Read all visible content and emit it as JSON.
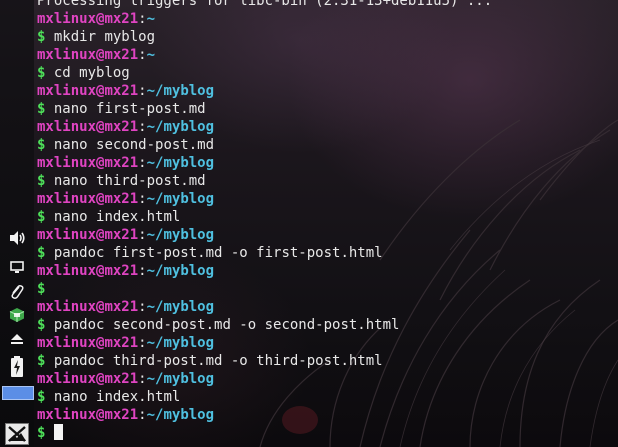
{
  "terminal": {
    "user": "mxlinux",
    "host": "mx21",
    "lines": [
      {
        "type": "output",
        "text": "Processing triggers for libc-bin (2.31-13+deb11u5) ..."
      },
      {
        "type": "prompt",
        "path": "~"
      },
      {
        "type": "command",
        "text": "mkdir myblog"
      },
      {
        "type": "prompt",
        "path": "~"
      },
      {
        "type": "command",
        "text": "cd myblog"
      },
      {
        "type": "prompt",
        "path": "~/myblog"
      },
      {
        "type": "command",
        "text": "nano first-post.md"
      },
      {
        "type": "prompt",
        "path": "~/myblog"
      },
      {
        "type": "command",
        "text": "nano second-post.md"
      },
      {
        "type": "prompt",
        "path": "~/myblog"
      },
      {
        "type": "command",
        "text": "nano third-post.md"
      },
      {
        "type": "prompt",
        "path": "~/myblog"
      },
      {
        "type": "command",
        "text": "nano index.html"
      },
      {
        "type": "prompt",
        "path": "~/myblog"
      },
      {
        "type": "command",
        "text": "pandoc first-post.md -o first-post.html"
      },
      {
        "type": "prompt",
        "path": "~/myblog"
      },
      {
        "type": "command",
        "text": ""
      },
      {
        "type": "prompt",
        "path": "~/myblog"
      },
      {
        "type": "command",
        "text": "pandoc second-post.md -o second-post.html"
      },
      {
        "type": "prompt",
        "path": "~/myblog"
      },
      {
        "type": "command",
        "text": "pandoc third-post.md -o third-post.html"
      },
      {
        "type": "prompt",
        "path": "~/myblog"
      },
      {
        "type": "command",
        "text": "nano index.html"
      },
      {
        "type": "prompt",
        "path": "~/myblog"
      },
      {
        "type": "active",
        "text": ""
      }
    ],
    "prompt_symbol": "$",
    "at_symbol": "@",
    "colon_symbol": ":"
  },
  "panel": {
    "tray_icons": [
      "volume-icon",
      "display-icon",
      "paperclip-icon",
      "package-updater-icon",
      "eject-icon",
      "battery-charging-icon"
    ],
    "workspace_color": "#5b8ee6",
    "menu_icon": "mx-logo-icon"
  },
  "colors": {
    "prompt_user": "#e044c2",
    "prompt_path": "#4fc0e0",
    "prompt_dollar": "#4ee05a",
    "text": "#e8e8e8"
  }
}
